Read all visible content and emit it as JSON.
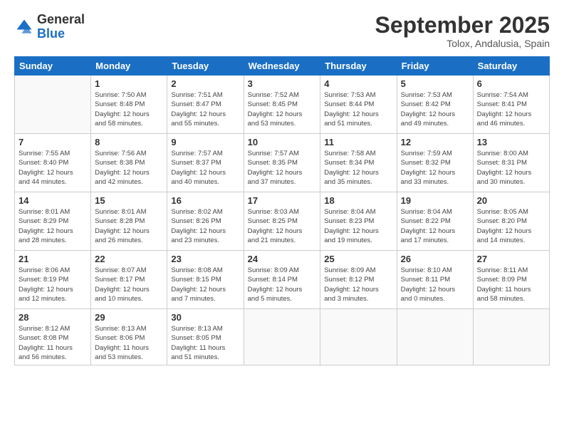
{
  "header": {
    "logo_general": "General",
    "logo_blue": "Blue",
    "month": "September 2025",
    "location": "Tolox, Andalusia, Spain"
  },
  "weekdays": [
    "Sunday",
    "Monday",
    "Tuesday",
    "Wednesday",
    "Thursday",
    "Friday",
    "Saturday"
  ],
  "weeks": [
    [
      {
        "day": "",
        "info": ""
      },
      {
        "day": "1",
        "info": "Sunrise: 7:50 AM\nSunset: 8:48 PM\nDaylight: 12 hours\nand 58 minutes."
      },
      {
        "day": "2",
        "info": "Sunrise: 7:51 AM\nSunset: 8:47 PM\nDaylight: 12 hours\nand 55 minutes."
      },
      {
        "day": "3",
        "info": "Sunrise: 7:52 AM\nSunset: 8:45 PM\nDaylight: 12 hours\nand 53 minutes."
      },
      {
        "day": "4",
        "info": "Sunrise: 7:53 AM\nSunset: 8:44 PM\nDaylight: 12 hours\nand 51 minutes."
      },
      {
        "day": "5",
        "info": "Sunrise: 7:53 AM\nSunset: 8:42 PM\nDaylight: 12 hours\nand 49 minutes."
      },
      {
        "day": "6",
        "info": "Sunrise: 7:54 AM\nSunset: 8:41 PM\nDaylight: 12 hours\nand 46 minutes."
      }
    ],
    [
      {
        "day": "7",
        "info": "Sunrise: 7:55 AM\nSunset: 8:40 PM\nDaylight: 12 hours\nand 44 minutes."
      },
      {
        "day": "8",
        "info": "Sunrise: 7:56 AM\nSunset: 8:38 PM\nDaylight: 12 hours\nand 42 minutes."
      },
      {
        "day": "9",
        "info": "Sunrise: 7:57 AM\nSunset: 8:37 PM\nDaylight: 12 hours\nand 40 minutes."
      },
      {
        "day": "10",
        "info": "Sunrise: 7:57 AM\nSunset: 8:35 PM\nDaylight: 12 hours\nand 37 minutes."
      },
      {
        "day": "11",
        "info": "Sunrise: 7:58 AM\nSunset: 8:34 PM\nDaylight: 12 hours\nand 35 minutes."
      },
      {
        "day": "12",
        "info": "Sunrise: 7:59 AM\nSunset: 8:32 PM\nDaylight: 12 hours\nand 33 minutes."
      },
      {
        "day": "13",
        "info": "Sunrise: 8:00 AM\nSunset: 8:31 PM\nDaylight: 12 hours\nand 30 minutes."
      }
    ],
    [
      {
        "day": "14",
        "info": "Sunrise: 8:01 AM\nSunset: 8:29 PM\nDaylight: 12 hours\nand 28 minutes."
      },
      {
        "day": "15",
        "info": "Sunrise: 8:01 AM\nSunset: 8:28 PM\nDaylight: 12 hours\nand 26 minutes."
      },
      {
        "day": "16",
        "info": "Sunrise: 8:02 AM\nSunset: 8:26 PM\nDaylight: 12 hours\nand 23 minutes."
      },
      {
        "day": "17",
        "info": "Sunrise: 8:03 AM\nSunset: 8:25 PM\nDaylight: 12 hours\nand 21 minutes."
      },
      {
        "day": "18",
        "info": "Sunrise: 8:04 AM\nSunset: 8:23 PM\nDaylight: 12 hours\nand 19 minutes."
      },
      {
        "day": "19",
        "info": "Sunrise: 8:04 AM\nSunset: 8:22 PM\nDaylight: 12 hours\nand 17 minutes."
      },
      {
        "day": "20",
        "info": "Sunrise: 8:05 AM\nSunset: 8:20 PM\nDaylight: 12 hours\nand 14 minutes."
      }
    ],
    [
      {
        "day": "21",
        "info": "Sunrise: 8:06 AM\nSunset: 8:19 PM\nDaylight: 12 hours\nand 12 minutes."
      },
      {
        "day": "22",
        "info": "Sunrise: 8:07 AM\nSunset: 8:17 PM\nDaylight: 12 hours\nand 10 minutes."
      },
      {
        "day": "23",
        "info": "Sunrise: 8:08 AM\nSunset: 8:15 PM\nDaylight: 12 hours\nand 7 minutes."
      },
      {
        "day": "24",
        "info": "Sunrise: 8:09 AM\nSunset: 8:14 PM\nDaylight: 12 hours\nand 5 minutes."
      },
      {
        "day": "25",
        "info": "Sunrise: 8:09 AM\nSunset: 8:12 PM\nDaylight: 12 hours\nand 3 minutes."
      },
      {
        "day": "26",
        "info": "Sunrise: 8:10 AM\nSunset: 8:11 PM\nDaylight: 12 hours\nand 0 minutes."
      },
      {
        "day": "27",
        "info": "Sunrise: 8:11 AM\nSunset: 8:09 PM\nDaylight: 11 hours\nand 58 minutes."
      }
    ],
    [
      {
        "day": "28",
        "info": "Sunrise: 8:12 AM\nSunset: 8:08 PM\nDaylight: 11 hours\nand 56 minutes."
      },
      {
        "day": "29",
        "info": "Sunrise: 8:13 AM\nSunset: 8:06 PM\nDaylight: 11 hours\nand 53 minutes."
      },
      {
        "day": "30",
        "info": "Sunrise: 8:13 AM\nSunset: 8:05 PM\nDaylight: 11 hours\nand 51 minutes."
      },
      {
        "day": "",
        "info": ""
      },
      {
        "day": "",
        "info": ""
      },
      {
        "day": "",
        "info": ""
      },
      {
        "day": "",
        "info": ""
      }
    ]
  ]
}
